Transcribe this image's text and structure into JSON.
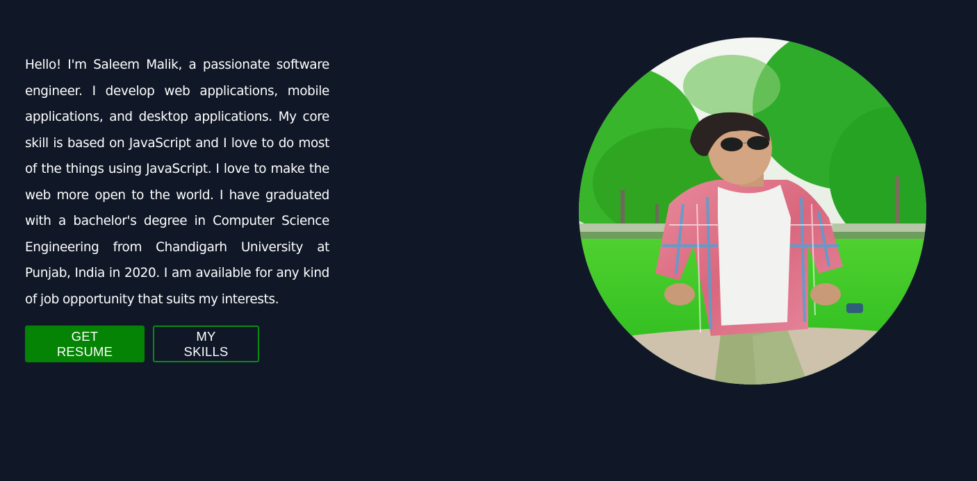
{
  "about": {
    "bio": "Hello! I'm Saleem Malik, a passionate software engineer. I develop web applications, mobile applications, and desktop applications. My core skill is based on JavaScript and I love to do most of the things using JavaScript. I love to make the web more open to the world. I have graduated with a bachelor's degree in Computer Science Engineering from Chandigarh University at Punjab, India in 2020. I am available for any kind of job opportunity that suits my interests."
  },
  "actions": {
    "resume_label": "GET RESUME",
    "skills_label": "MY SKILLS"
  },
  "profile": {
    "photo_icon": "profile-photo"
  },
  "colors": {
    "background": "#101828",
    "primary": "#048304",
    "outline": "#0b8a16",
    "text": "#ffffff"
  }
}
